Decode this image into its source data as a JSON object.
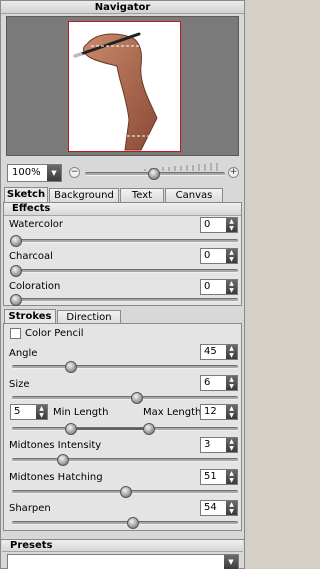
{
  "navigator": {
    "title": "Navigator",
    "zoom_value": "100%",
    "zoom_minus": "−",
    "zoom_plus": "+"
  },
  "main_tabs": [
    "Sketch",
    "Background",
    "Text",
    "Canvas"
  ],
  "effects": {
    "title": "Effects",
    "watercolor": {
      "label": "Watercolor",
      "value": "0"
    },
    "charcoal": {
      "label": "Charcoal",
      "value": "0"
    },
    "coloration": {
      "label": "Coloration",
      "value": "0"
    }
  },
  "strokes_tabs": [
    "Strokes",
    "Direction"
  ],
  "strokes": {
    "color_pencil": "Color Pencil",
    "angle": {
      "label": "Angle",
      "value": "45"
    },
    "size": {
      "label": "Size",
      "value": "6"
    },
    "min_length": {
      "label": "Min Length",
      "value": "5"
    },
    "max_length": {
      "label": "Max Length",
      "value": "12"
    },
    "midtones_intensity": {
      "label": "Midtones Intensity",
      "value": "3"
    },
    "midtones_hatching": {
      "label": "Midtones Hatching",
      "value": "51"
    },
    "sharpen": {
      "label": "Sharpen",
      "value": "54"
    }
  },
  "presets": {
    "title": "Presets",
    "selected": ""
  }
}
